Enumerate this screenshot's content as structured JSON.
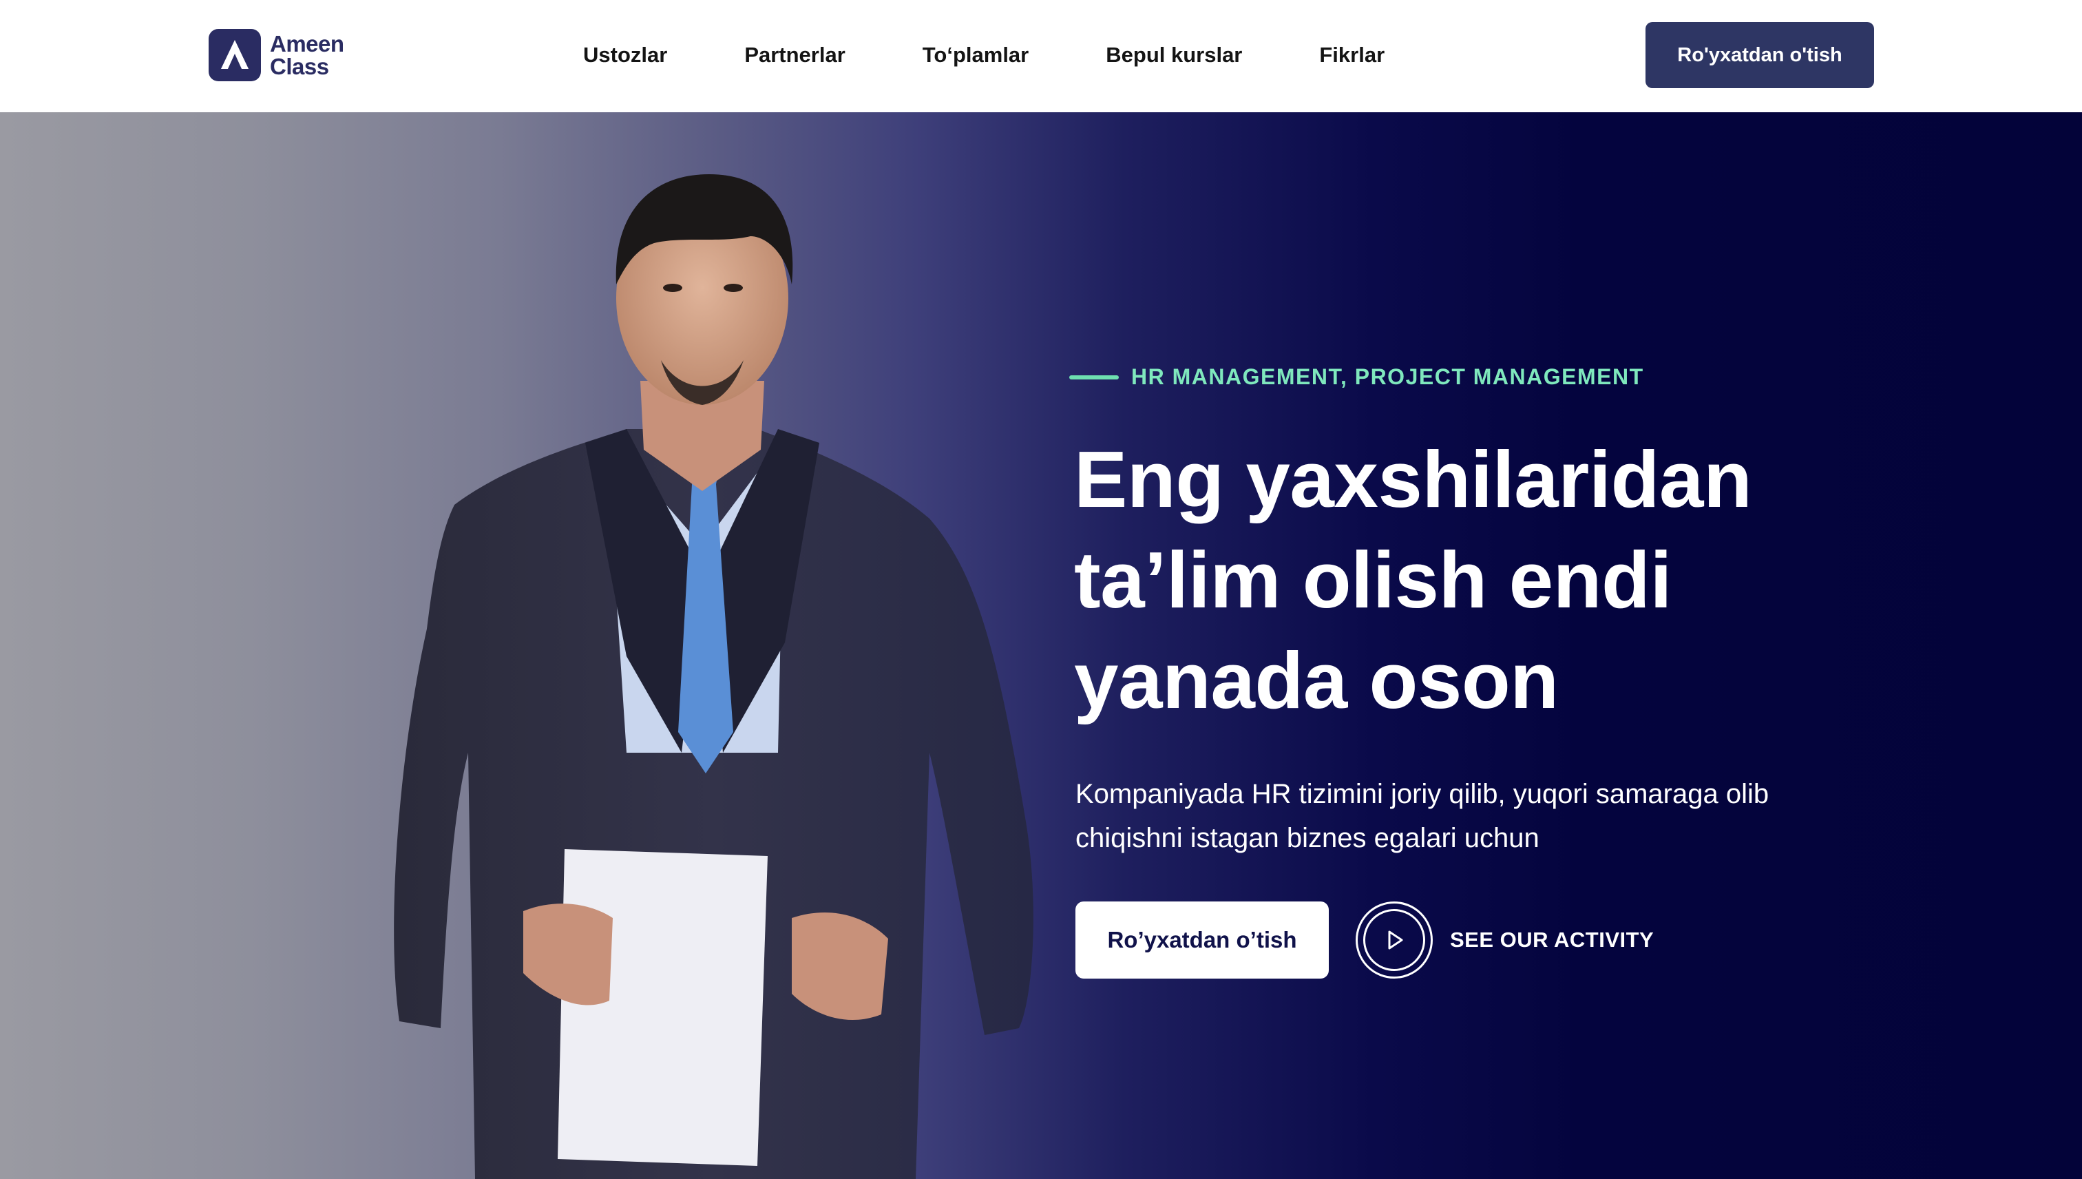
{
  "brand": {
    "line1": "Ameen",
    "line2": "Class",
    "icon": "ameen-logo-icon",
    "color": "#2a2c62"
  },
  "nav": {
    "items": [
      {
        "label": "Ustozlar"
      },
      {
        "label": "Partnerlar"
      },
      {
        "label": "To‘plamlar"
      },
      {
        "label": "Bepul kurslar"
      },
      {
        "label": "Fikrlar"
      }
    ],
    "cta_label": "Ro'yxatdan o'tish"
  },
  "hero": {
    "eyebrow": "HR MANAGEMENT, PROJECT MANAGEMENT",
    "headline": [
      "Eng yaxshilaridan",
      "ta’lim olish endi",
      "yanada oson"
    ],
    "subtitle": [
      "Kompaniyada HR tizimini joriy qilib, yuqori samaraga olib",
      "chiqishni istagan biznes egalari uchun"
    ],
    "cta_label": "Ro’yxatdan o’tish",
    "secondary_label": "SEE OUR ACTIVITY",
    "play_icon": "play-icon"
  },
  "colors": {
    "accent": "#7fe8bd",
    "navy": "#030339",
    "button_dark": "#2e3664"
  }
}
